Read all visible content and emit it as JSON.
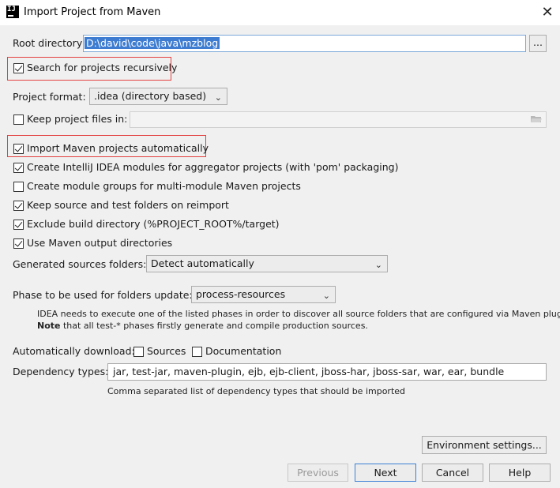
{
  "window": {
    "title": "Import Project from Maven",
    "app_icon_text": "IJ"
  },
  "root_directory": {
    "label": "Root directory",
    "value": "D:\\david\\code\\java\\mzblog",
    "browse_label": "..."
  },
  "search_recursive": {
    "label": "Search for projects recursively",
    "checked": true
  },
  "project_format": {
    "label": "Project format:",
    "value": ".idea (directory based)"
  },
  "keep_files": {
    "label": "Keep project files in:",
    "checked": false,
    "value": ""
  },
  "options": [
    {
      "label": "Import Maven projects automatically",
      "checked": true
    },
    {
      "label": "Create IntelliJ IDEA modules for aggregator projects (with 'pom' packaging)",
      "checked": true
    },
    {
      "label": "Create module groups for multi-module Maven projects",
      "checked": false
    },
    {
      "label": "Keep source and test folders on reimport",
      "checked": true
    },
    {
      "label": "Exclude build directory (%PROJECT_ROOT%/target)",
      "checked": true
    },
    {
      "label": "Use Maven output directories",
      "checked": true
    }
  ],
  "generated_sources": {
    "label": "Generated sources folders:",
    "value": "Detect automatically"
  },
  "phase": {
    "label": "Phase to be used for folders update:",
    "value": "process-resources",
    "help_line1": "IDEA needs to execute one of the listed phases in order to discover all source folders that are configured via Maven plugins.",
    "help_note_bold": "Note",
    "help_line2": " that all test-* phases firstly generate and compile production sources."
  },
  "auto_download": {
    "label": "Automatically download:",
    "sources_label": "Sources",
    "sources_checked": false,
    "docs_label": "Documentation",
    "docs_checked": false
  },
  "dependency_types": {
    "label": "Dependency types:",
    "value": "jar, test-jar, maven-plugin, ejb, ejb-client, jboss-har, jboss-sar, war, ear, bundle",
    "hint": "Comma separated list of dependency types that should be imported"
  },
  "buttons": {
    "environment": "Environment settings...",
    "previous": "Previous",
    "next": "Next",
    "cancel": "Cancel",
    "help": "Help"
  }
}
